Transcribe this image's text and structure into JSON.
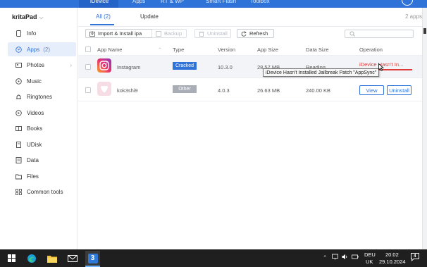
{
  "topnav": {
    "tabs": [
      {
        "label": "iDevice"
      },
      {
        "label": "Apps"
      },
      {
        "label": "RT & WP"
      },
      {
        "label": "Smart Flash"
      },
      {
        "label": "Toolbox"
      }
    ]
  },
  "sidebar": {
    "device_name": "kritaPad",
    "items": [
      {
        "label": "Info",
        "icon": "info-icon"
      },
      {
        "label": "Apps",
        "count": "(2)",
        "icon": "apps-icon"
      },
      {
        "label": "Photos",
        "icon": "photos-icon"
      },
      {
        "label": "Music",
        "icon": "music-icon"
      },
      {
        "label": "Ringtones",
        "icon": "bell-icon"
      },
      {
        "label": "Videos",
        "icon": "video-icon"
      },
      {
        "label": "Books",
        "icon": "book-icon"
      },
      {
        "label": "UDisk",
        "icon": "udisk-icon"
      },
      {
        "label": "Data",
        "icon": "data-icon"
      },
      {
        "label": "Files",
        "icon": "folder-icon"
      },
      {
        "label": "Common tools",
        "icon": "grid-icon"
      }
    ]
  },
  "main": {
    "subtabs": [
      {
        "label": "All (2)"
      },
      {
        "label": "Update"
      }
    ],
    "app_count": "2 apps",
    "toolbar": {
      "import_label": "Import & Install ipa",
      "backup_label": "Backup",
      "uninstall_label": "Uninstall",
      "refresh_label": "Refresh",
      "search_placeholder": ""
    },
    "columns": [
      "App Name",
      "Type",
      "Version",
      "App Size",
      "Data Size",
      "Operation"
    ],
    "rows": [
      {
        "name": "Instagram",
        "type": "Cracked",
        "version": "10.3.0",
        "app_size": "28.57 MB",
        "data_size": "Reading...",
        "operation": "iDevice Hasn't In..."
      },
      {
        "name": "kok3shi9",
        "type": "Other",
        "version": "4.0.3",
        "app_size": "26.63 MB",
        "data_size": "240.00 KB",
        "view_label": "View",
        "uninstall_label": "Uninstall"
      }
    ],
    "tooltip": "iDevice Hasn't Installed Jailbreak Patch \"AppSync\""
  },
  "taskbar": {
    "active_app_label": "3",
    "language": "DEU",
    "region": "UK",
    "time": "20:02",
    "date": "29.10.2024",
    "notification_count": "4"
  },
  "colors": {
    "accent": "#2f73d8",
    "cracked_badge": "#2f73d8",
    "other_badge": "#a9adb5",
    "error_text": "#e13a3a"
  }
}
